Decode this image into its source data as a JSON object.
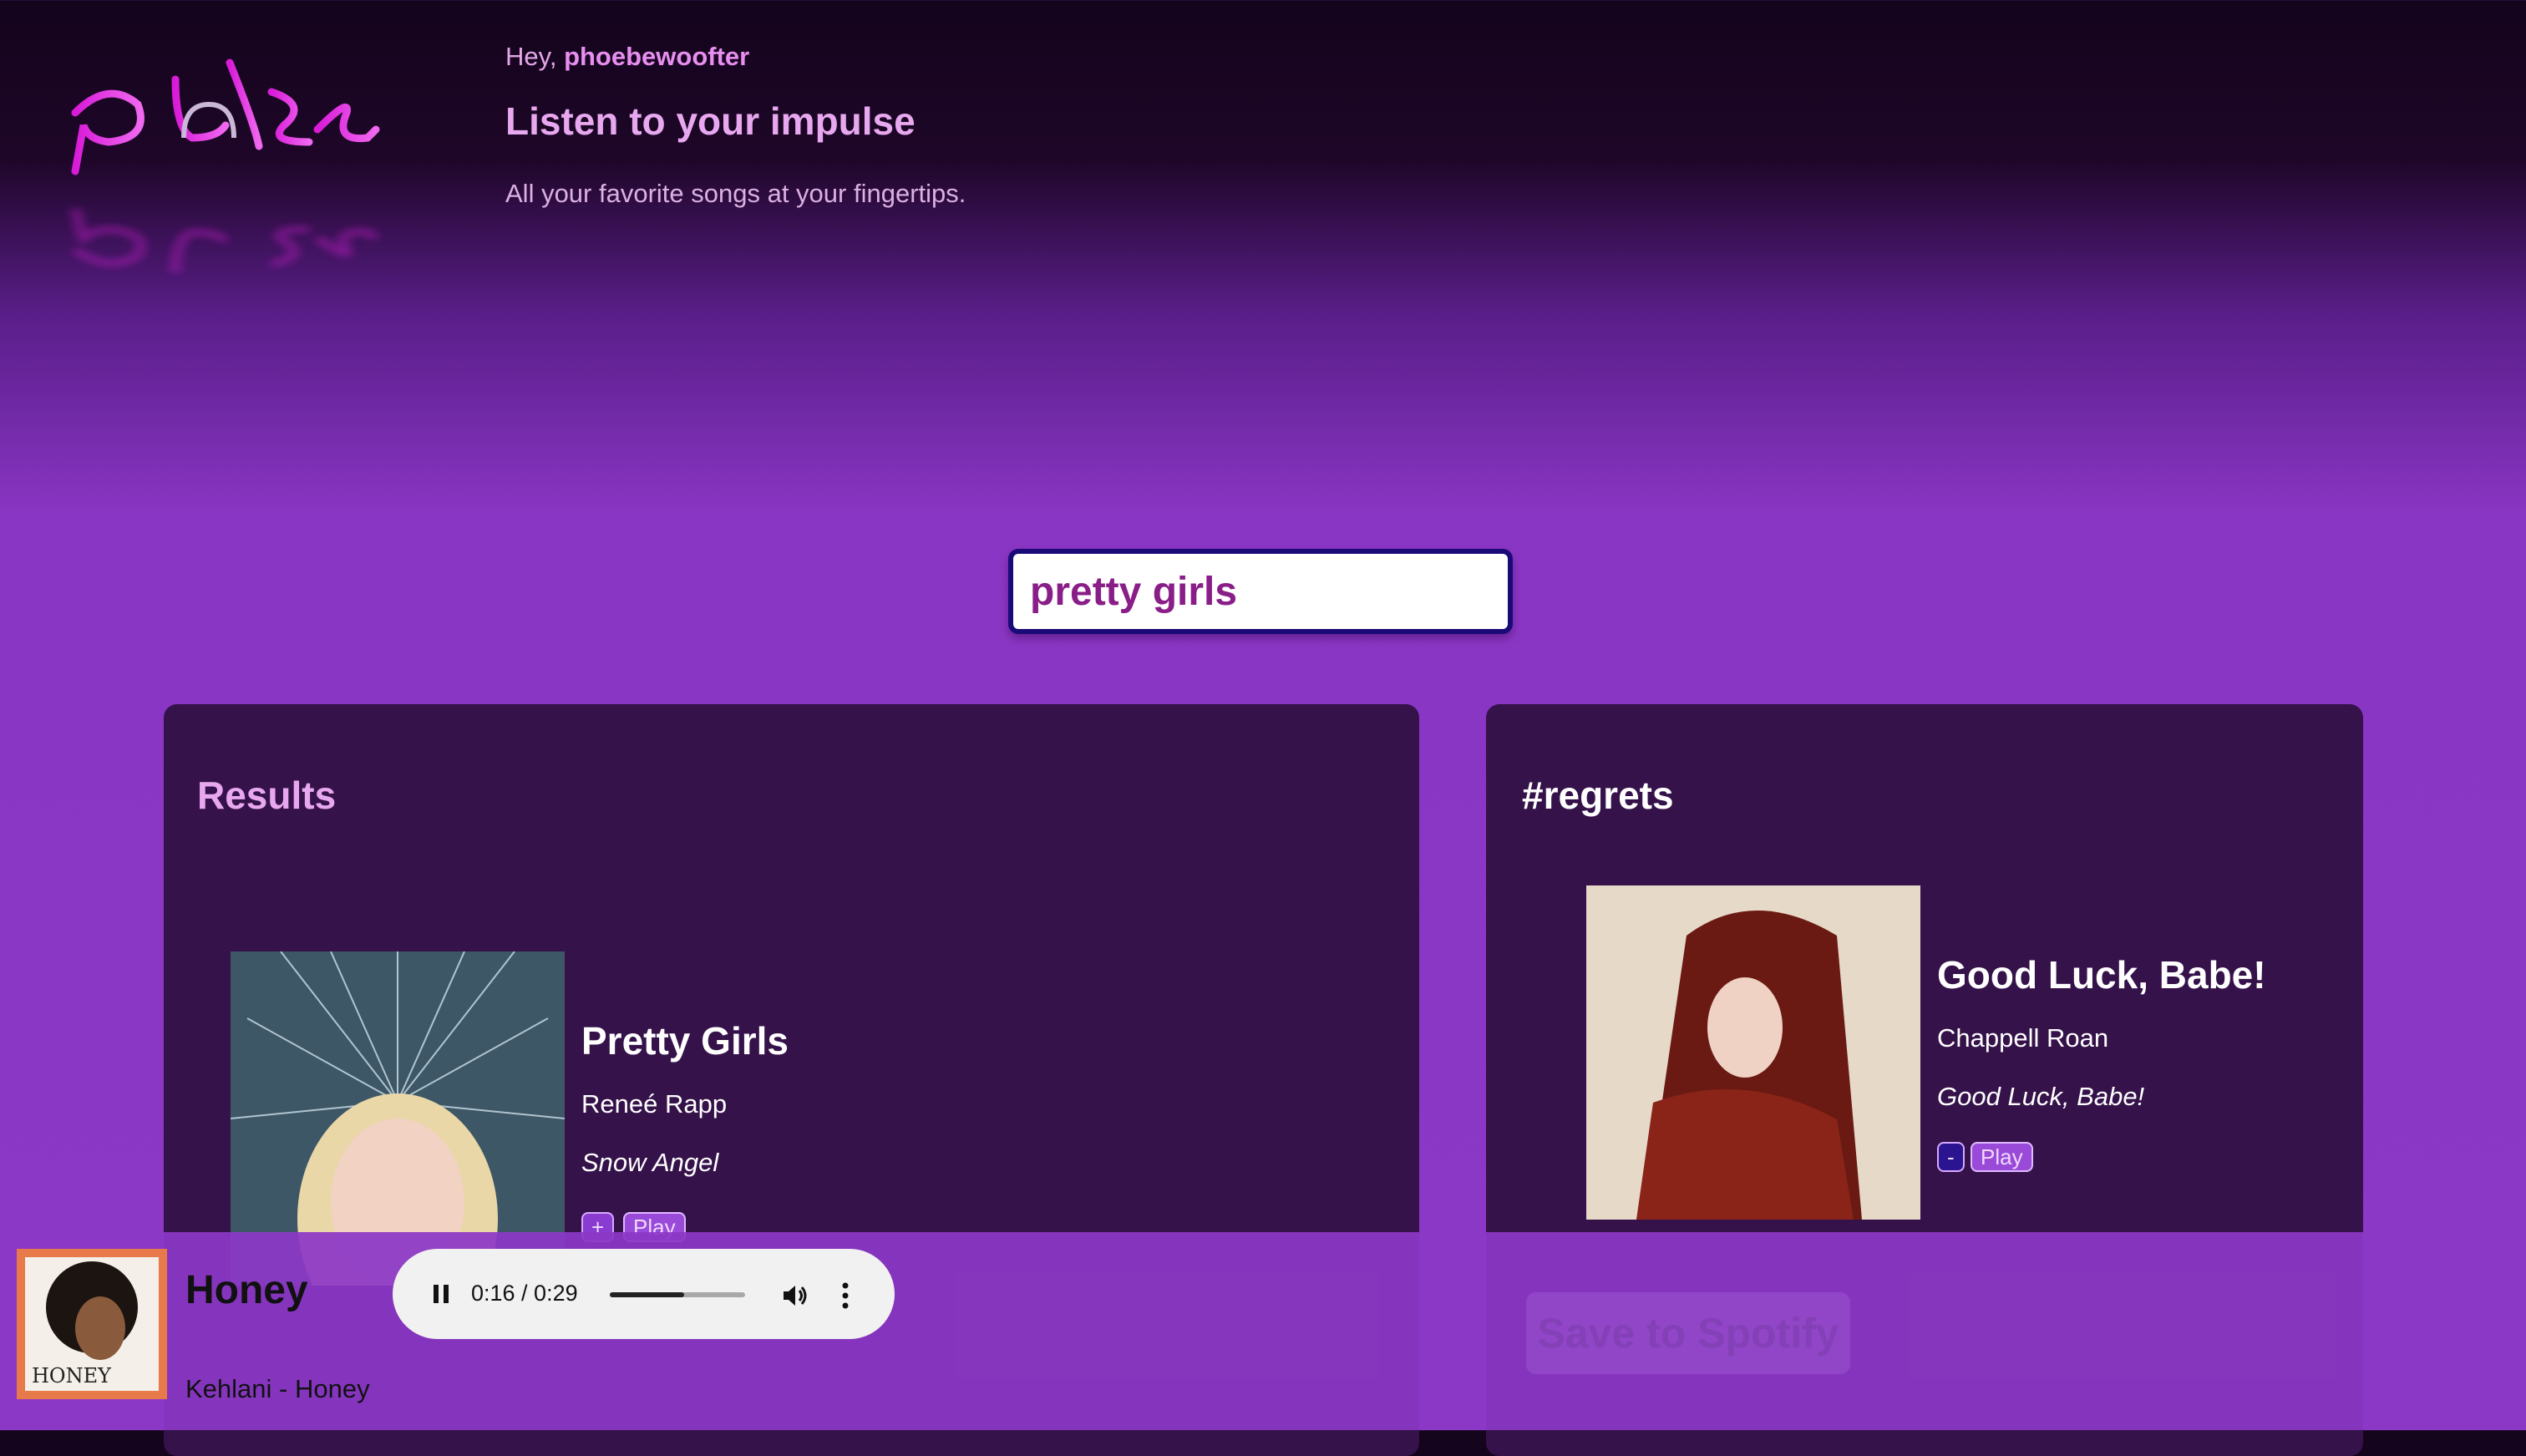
{
  "app": {
    "logo_text": "pulse"
  },
  "header": {
    "greeting_prefix": "Hey, ",
    "username": "phoebewoofter",
    "headline": "Listen to your impulse",
    "tagline": "All your favorite songs at your fingertips."
  },
  "search": {
    "value": "pretty girls"
  },
  "results": {
    "title": "Results",
    "tracks": [
      {
        "title": "Pretty Girls",
        "artist": "Reneé Rapp",
        "album": "Snow Angel",
        "add_label": "+",
        "play_label": "Play"
      }
    ]
  },
  "playlist": {
    "title": "#regrets",
    "tracks": [
      {
        "title": "Good Luck, Babe!",
        "artist": "Chappell Roan",
        "album": "Good Luck, Babe!",
        "remove_label": "-",
        "play_label": "Play"
      }
    ],
    "save_label": "Save to Spotify"
  },
  "now_playing": {
    "title": "Honey",
    "subtitle": "Kehlani - Honey",
    "cover_text": "HONEY",
    "time": "0:16 / 0:29",
    "progress": 0.55
  },
  "colors": {
    "accent_pink": "#e88ef0",
    "panel": "#35124a",
    "bar": "#8c38c6",
    "search_border": "#1a0a78"
  }
}
